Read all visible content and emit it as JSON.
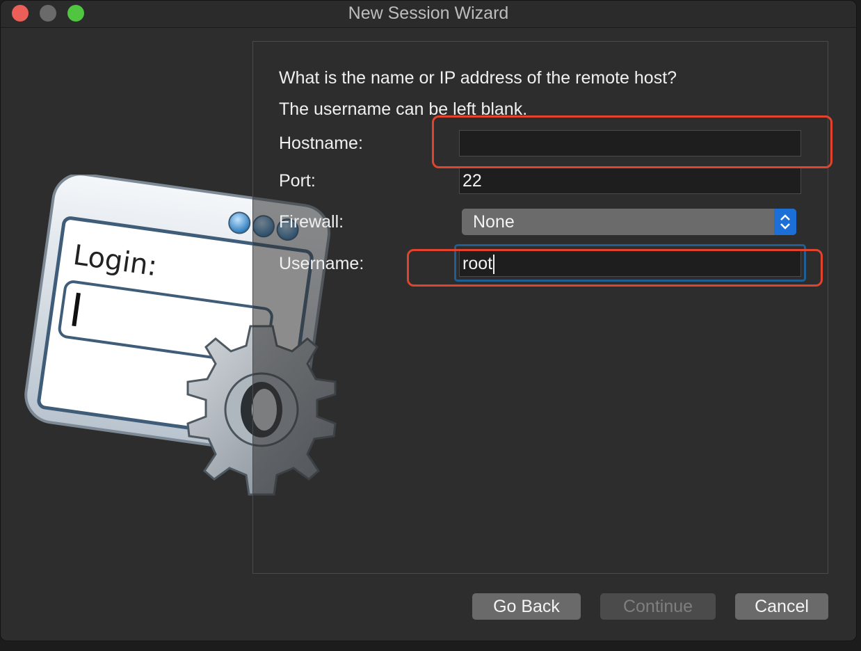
{
  "window": {
    "title": "New Session Wizard"
  },
  "prompt": {
    "line1": "What is the name or IP address of the remote host?",
    "line2": "The username can be left blank."
  },
  "artwork": {
    "text": "Login:"
  },
  "form": {
    "hostname": {
      "label": "Hostname:",
      "value": ""
    },
    "port": {
      "label": "Port:",
      "value": "22"
    },
    "firewall": {
      "label": "Firewall:",
      "selected": "None"
    },
    "username": {
      "label": "Username:",
      "value": "root"
    }
  },
  "buttons": {
    "back": "Go Back",
    "continue": "Continue",
    "cancel": "Cancel"
  },
  "colors": {
    "accent": "#1d6fd8",
    "highlight": "#e2432d",
    "focus": "#1f5f93"
  }
}
